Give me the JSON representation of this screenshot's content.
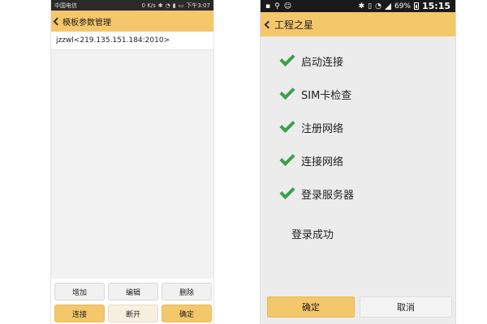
{
  "left_phone": {
    "status_bar": {
      "carrier": "中国电信",
      "speed": "0 K/s",
      "icons": [
        "bluetooth-icon",
        "wifi-icon",
        "signal-icon",
        "battery-icon"
      ],
      "time": "下午3:07"
    },
    "title": "模板参数管理",
    "list": [
      {
        "label": "jzzwl<219.135.151.184:2010>"
      }
    ],
    "buttons_row1": {
      "add": "增加",
      "edit": "编辑",
      "delete": "删除"
    },
    "buttons_row2": {
      "connect": "连接",
      "disconnect": "断开",
      "confirm": "确定"
    },
    "colors": {
      "accent": "#f5c76b"
    }
  },
  "right_phone": {
    "status_bar": {
      "icons": [
        "notification-icon",
        "usb-icon",
        "android-icon",
        "bluetooth-icon",
        "vibrate-icon",
        "wifi-icon",
        "signal-icon",
        "battery-icon"
      ],
      "battery": "69%",
      "time": "15:15"
    },
    "title": "工程之星",
    "steps": [
      {
        "label": "启动连接",
        "status": "done"
      },
      {
        "label": "SIM卡检查",
        "status": "done"
      },
      {
        "label": "注册网络",
        "status": "done"
      },
      {
        "label": "连接网络",
        "status": "done"
      },
      {
        "label": "登录服务器",
        "status": "done"
      }
    ],
    "result": "登录成功",
    "buttons": {
      "ok": "确定",
      "cancel": "取消"
    },
    "colors": {
      "accent": "#f5c76b",
      "check": "#3aa048"
    }
  }
}
